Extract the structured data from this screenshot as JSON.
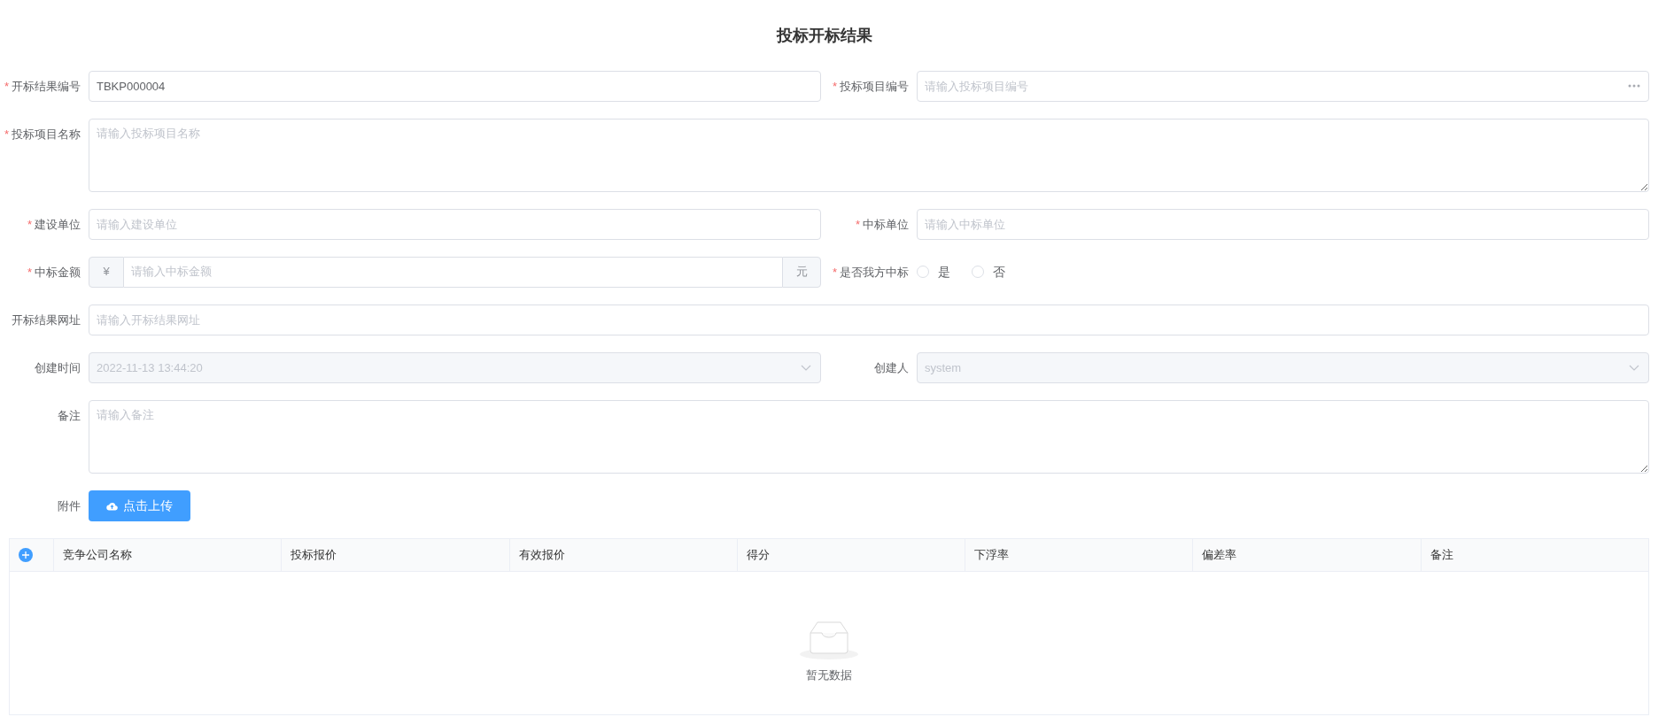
{
  "title": "投标开标结果",
  "form_rows": [
    [
      {
        "label": "开标结果编号",
        "required_mark": "*",
        "kind": "text",
        "value": "TBKP000004"
      },
      {
        "label": "投标项目编号",
        "required_mark": "*",
        "kind": "lookup",
        "placeholder": "请输入投标项目编号"
      }
    ],
    [
      {
        "label": "投标项目名称",
        "required_mark": "*",
        "kind": "textarea",
        "placeholder": "请输入投标项目名称"
      }
    ],
    [
      {
        "label": "建设单位",
        "required_mark": "*",
        "kind": "text",
        "placeholder": "请输入建设单位"
      },
      {
        "label": "中标单位",
        "required_mark": "*",
        "kind": "text",
        "placeholder": "请输入中标单位"
      }
    ],
    [
      {
        "label": "中标金额",
        "required_mark": "*",
        "kind": "amount",
        "prefix": "¥",
        "placeholder": "请输入中标金额",
        "suffix": "元"
      },
      {
        "label": "是否我方中标",
        "required_mark": "*",
        "kind": "radio",
        "options": [
          {
            "label": "是",
            "selected": false
          },
          {
            "label": "否",
            "selected": false
          }
        ]
      }
    ],
    [
      {
        "label": "开标结果网址",
        "kind": "text",
        "placeholder": "请输入开标结果网址"
      }
    ],
    [
      {
        "label": "创建时间",
        "kind": "select",
        "disabled": true,
        "value": "2022-11-13 13:44:20"
      },
      {
        "label": "创建人",
        "kind": "select",
        "disabled": true,
        "value": "system"
      }
    ],
    [
      {
        "label": "备注",
        "kind": "textarea",
        "placeholder": "请输入备注"
      }
    ],
    [
      {
        "label": "附件",
        "kind": "upload",
        "button_label": "点击上传"
      }
    ]
  ],
  "table": {
    "columns": [
      "竞争公司名称",
      "投标报价",
      "有效报价",
      "得分",
      "下浮率",
      "偏差率",
      "备注"
    ],
    "empty_text": "暂无数据"
  }
}
